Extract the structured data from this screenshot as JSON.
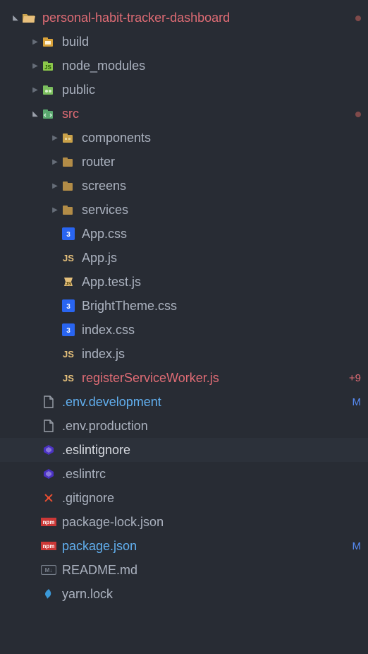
{
  "tree": [
    {
      "id": "root",
      "depth": 0,
      "arrow": "down",
      "icon": "folder-open-mod",
      "label": "personal-habit-tracker-dashboard",
      "color": "c-mod",
      "status": "dot",
      "interactable": true
    },
    {
      "id": "build",
      "depth": 1,
      "arrow": "right",
      "icon": "folder-build",
      "label": "build",
      "interactable": true
    },
    {
      "id": "node_modules",
      "depth": 1,
      "arrow": "right",
      "icon": "folder-node",
      "label": "node_modules",
      "interactable": true
    },
    {
      "id": "public",
      "depth": 1,
      "arrow": "right",
      "icon": "folder-public",
      "label": "public",
      "interactable": true
    },
    {
      "id": "src",
      "depth": 1,
      "arrow": "down",
      "icon": "folder-src",
      "label": "src",
      "color": "c-mod",
      "status": "dot",
      "interactable": true
    },
    {
      "id": "components",
      "depth": 2,
      "arrow": "right",
      "icon": "folder-closed-y",
      "label": "components",
      "interactable": true
    },
    {
      "id": "router",
      "depth": 2,
      "arrow": "right",
      "icon": "folder-closed",
      "label": "router",
      "interactable": true
    },
    {
      "id": "screens",
      "depth": 2,
      "arrow": "right",
      "icon": "folder-closed",
      "label": "screens",
      "interactable": true
    },
    {
      "id": "services",
      "depth": 2,
      "arrow": "right",
      "icon": "folder-closed",
      "label": "services",
      "interactable": true
    },
    {
      "id": "appcss",
      "depth": 2,
      "arrow": "none",
      "icon": "css",
      "label": "App.css",
      "interactable": true
    },
    {
      "id": "appjs",
      "depth": 2,
      "arrow": "none",
      "icon": "js",
      "label": "App.js",
      "interactable": true
    },
    {
      "id": "apptest",
      "depth": 2,
      "arrow": "none",
      "icon": "jstest",
      "label": "App.test.js",
      "interactable": true
    },
    {
      "id": "bright",
      "depth": 2,
      "arrow": "none",
      "icon": "css",
      "label": "BrightTheme.css",
      "interactable": true
    },
    {
      "id": "indexcss",
      "depth": 2,
      "arrow": "none",
      "icon": "css",
      "label": "index.css",
      "interactable": true
    },
    {
      "id": "indexjs",
      "depth": 2,
      "arrow": "none",
      "icon": "js",
      "label": "index.js",
      "interactable": true
    },
    {
      "id": "rsw",
      "depth": 2,
      "arrow": "none",
      "icon": "js",
      "label": "registerServiceWorker.js",
      "color": "c-mod",
      "status": "+9",
      "statusColor": "#e06c75",
      "interactable": true
    },
    {
      "id": "envdev",
      "depth": 1,
      "arrow": "none",
      "icon": "file",
      "label": ".env.development",
      "color": "c-link",
      "status": "M",
      "interactable": true
    },
    {
      "id": "envprod",
      "depth": 1,
      "arrow": "none",
      "icon": "file",
      "label": ".env.production",
      "interactable": true
    },
    {
      "id": "eslintignore",
      "depth": 1,
      "arrow": "none",
      "icon": "eslint",
      "label": ".eslintignore",
      "color": "c-bold",
      "selected": true,
      "interactable": true
    },
    {
      "id": "eslintrc",
      "depth": 1,
      "arrow": "none",
      "icon": "eslint",
      "label": ".eslintrc",
      "interactable": true
    },
    {
      "id": "gitignore",
      "depth": 1,
      "arrow": "none",
      "icon": "git",
      "label": ".gitignore",
      "interactable": true
    },
    {
      "id": "pkglock",
      "depth": 1,
      "arrow": "none",
      "icon": "npm",
      "label": "package-lock.json",
      "interactable": true
    },
    {
      "id": "pkg",
      "depth": 1,
      "arrow": "none",
      "icon": "npm",
      "label": "package.json",
      "color": "c-link",
      "status": "M",
      "interactable": true
    },
    {
      "id": "readme",
      "depth": 1,
      "arrow": "none",
      "icon": "md",
      "label": "README.md",
      "interactable": true
    },
    {
      "id": "yarnlock",
      "depth": 1,
      "arrow": "none",
      "icon": "yarn",
      "label": "yarn.lock",
      "interactable": true
    }
  ],
  "indent_base": 14,
  "indent_step": 28
}
